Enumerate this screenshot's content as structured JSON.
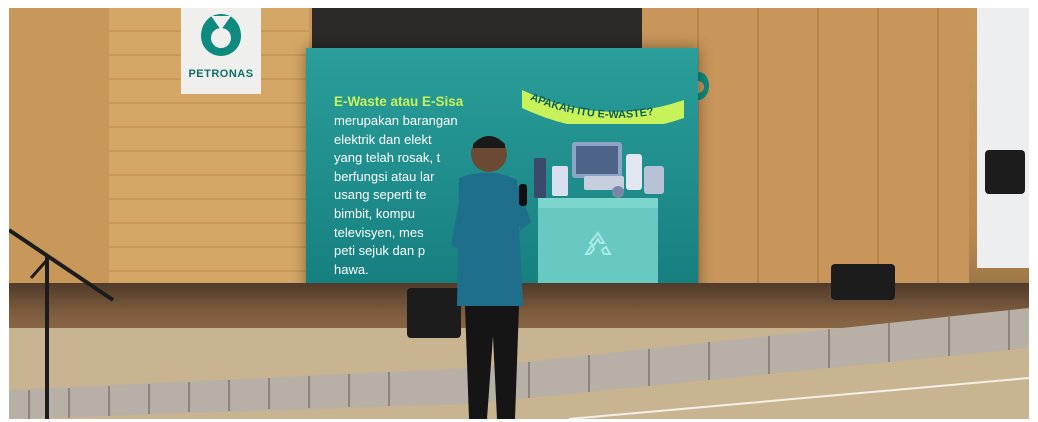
{
  "photo": {
    "venue_logo_text": "PETRONAS",
    "slide": {
      "title": "E-Waste atau E-Sisa",
      "body_lines": [
        "merupakan barangan",
        "elektrik dan elekt",
        "yang telah rosak, t",
        "berfungsi atau lar",
        "usang seperti te",
        "bimbit, kompu",
        "televisyen, mes",
        "peti sejuk dan p",
        "hawa."
      ],
      "banner_text": "APAKAH ITU E-WASTE?",
      "colors": {
        "background": "#1f8f8f",
        "title": "#c8f25a",
        "banner": "#c8f25a",
        "banner_text": "#0f5f5a"
      }
    },
    "recycle_icon": "recycle-icon"
  }
}
